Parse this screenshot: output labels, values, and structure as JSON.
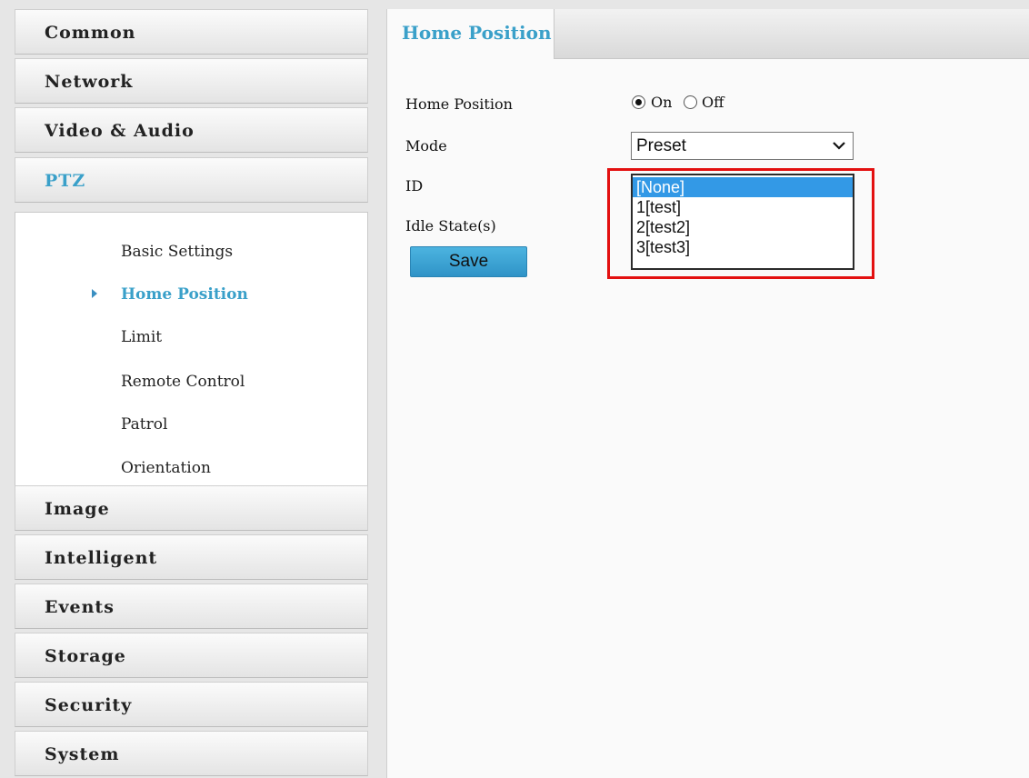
{
  "sidebar": {
    "items": [
      {
        "label": "Common"
      },
      {
        "label": "Network"
      },
      {
        "label": "Video & Audio"
      },
      {
        "label": "PTZ"
      },
      {
        "label": "Image"
      },
      {
        "label": "Intelligent"
      },
      {
        "label": "Events"
      },
      {
        "label": "Storage"
      },
      {
        "label": "Security"
      },
      {
        "label": "System"
      }
    ],
    "ptz_subitems": [
      {
        "label": "Basic Settings"
      },
      {
        "label": "Home Position"
      },
      {
        "label": "Limit"
      },
      {
        "label": "Remote Control"
      },
      {
        "label": "Patrol"
      },
      {
        "label": "Orientation"
      }
    ]
  },
  "main": {
    "tab_label": "Home Position",
    "form": {
      "home_position_label": "Home Position",
      "on_label": "On",
      "off_label": "Off",
      "home_position_value": "On",
      "mode_label": "Mode",
      "mode_value": "Preset",
      "id_label": "ID",
      "idle_state_label": "Idle State(s)",
      "id_options": [
        "[None]",
        "1[test]",
        "2[test2]",
        "3[test3]"
      ],
      "id_selected": "[None]",
      "save_label": "Save"
    }
  },
  "colors": {
    "accent": "#3aa0c9",
    "highlight_border": "#e31010",
    "selected_option": "#3399e6"
  },
  "icons": [
    "radio-on-icon",
    "radio-off-icon",
    "chevron-down-icon",
    "submenu-arrow-icon"
  ]
}
